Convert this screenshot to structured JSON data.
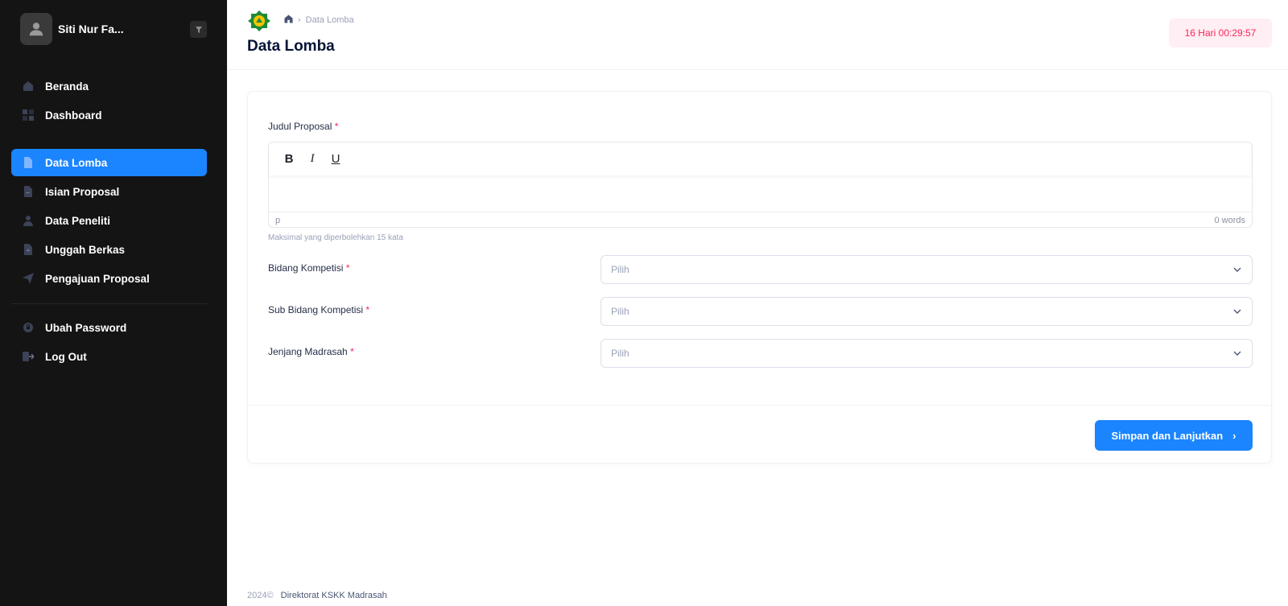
{
  "sidebar": {
    "user_name": "Siti Nur Fa...",
    "menu_primary": [
      {
        "label": "Beranda",
        "icon": "home-icon"
      },
      {
        "label": "Dashboard",
        "icon": "grid-icon"
      }
    ],
    "menu_main": [
      {
        "label": "Data Lomba",
        "icon": "file-icon",
        "active": true
      },
      {
        "label": "Isian Proposal",
        "icon": "document-text-icon"
      },
      {
        "label": "Data Peneliti",
        "icon": "user-icon"
      },
      {
        "label": "Unggah Berkas",
        "icon": "file-upload-icon"
      },
      {
        "label": "Pengajuan Proposal",
        "icon": "send-icon"
      }
    ],
    "menu_account": [
      {
        "label": "Ubah Password",
        "icon": "lock-icon"
      },
      {
        "label": "Log Out",
        "icon": "logout-icon"
      }
    ]
  },
  "header": {
    "breadcrumb_current": "Data Lomba",
    "title": "Data Lomba",
    "timer": "16 Hari 00:29:57"
  },
  "form": {
    "judul_label": "Judul Proposal",
    "required_mark": "*",
    "editor": {
      "bold": "B",
      "italic": "I",
      "underline": "U",
      "status_left": "p",
      "word_count": "0 words"
    },
    "hint": "Maksimal yang diperbolehkan 15 kata",
    "fields": [
      {
        "label": "Bidang Kompetisi ",
        "placeholder": "Pilih"
      },
      {
        "label": "Sub Bidang Kompetisi ",
        "placeholder": "Pilih"
      },
      {
        "label": "Jenjang Madrasah",
        "placeholder": "Pilih"
      }
    ],
    "submit_label": "Simpan dan Lanjutkan"
  },
  "footer": {
    "year": "2024©",
    "org": "Direktorat KSKK Madrasah"
  },
  "colors": {
    "sidebar_bg": "#141414",
    "primary": "#1b84ff",
    "danger": "#f8285a",
    "timer_bg": "#ffeef3"
  }
}
